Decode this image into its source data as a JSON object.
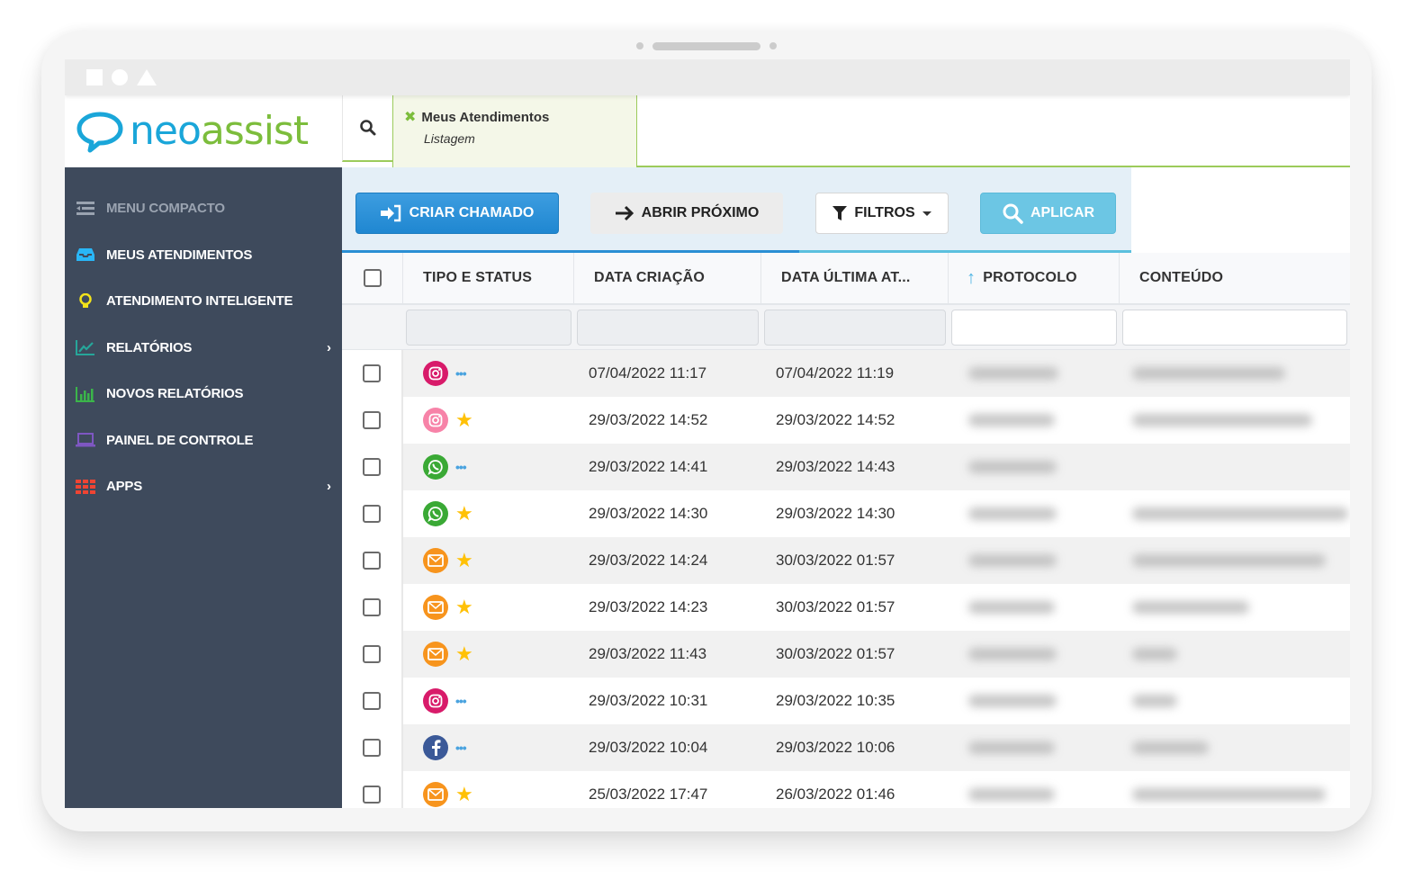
{
  "colors": {
    "brand_blue": "#1aa6d9",
    "brand_green": "#7cbd3c",
    "sidebar_bg": "#3e4a5c",
    "primary_button": "#1f87d1",
    "apply_button": "#6cc6e4",
    "star": "#ffc107",
    "instagram": "#d81b6a",
    "instagram_light": "#f783a8",
    "whatsapp": "#3aa935",
    "email": "#f7941d",
    "facebook": "#3b5998"
  },
  "header": {
    "logo_part1": "neo",
    "logo_part2": "assist",
    "search_icon": "search-icon",
    "active_tab": {
      "title": "Meus Atendimentos",
      "subtitle": "Listagem",
      "close_icon": "close-icon"
    }
  },
  "sidebar": {
    "items": [
      {
        "label": "MENU COMPACTO",
        "icon": "menu-compact-icon",
        "muted": true
      },
      {
        "label": "MEUS ATENDIMENTOS",
        "icon": "inbox-icon"
      },
      {
        "label": "ATENDIMENTO INTELIGENTE",
        "icon": "lightbulb-icon"
      },
      {
        "label": "RELATÓRIOS",
        "icon": "line-chart-icon",
        "has_submenu": true
      },
      {
        "label": "NOVOS RELATÓRIOS",
        "icon": "bar-chart-icon"
      },
      {
        "label": "PAINEL DE CONTROLE",
        "icon": "laptop-icon"
      },
      {
        "label": "APPS",
        "icon": "apps-grid-icon",
        "has_submenu": true
      }
    ]
  },
  "toolbar": {
    "create_label": "CRIAR CHAMADO",
    "next_label": "ABRIR PRÓXIMO",
    "filters_label": "FILTROS",
    "apply_label": "APLICAR"
  },
  "table": {
    "columns": [
      "TIPO E STATUS",
      "DATA CRIAÇÃO",
      "DATA ÚLTIMA AT...",
      "PROTOCOLO",
      "CONTEÚDO"
    ],
    "sorted_column": "PROTOCOLO",
    "sort_direction": "ascending",
    "rows": [
      {
        "channel": "instagram",
        "status": "in-progress",
        "created": "07/04/2022 11:17",
        "updated": "07/04/2022 11:19",
        "protocol": "",
        "content": ""
      },
      {
        "channel": "instagram-light",
        "status": "starred",
        "created": "29/03/2022 14:52",
        "updated": "29/03/2022 14:52",
        "protocol": "",
        "content": ""
      },
      {
        "channel": "whatsapp",
        "status": "in-progress",
        "created": "29/03/2022 14:41",
        "updated": "29/03/2022 14:43",
        "protocol": "",
        "content": ""
      },
      {
        "channel": "whatsapp",
        "status": "starred",
        "created": "29/03/2022 14:30",
        "updated": "29/03/2022 14:30",
        "protocol": "",
        "content": ""
      },
      {
        "channel": "email",
        "status": "starred",
        "created": "29/03/2022 14:24",
        "updated": "30/03/2022 01:57",
        "protocol": "",
        "content": ""
      },
      {
        "channel": "email",
        "status": "starred",
        "created": "29/03/2022 14:23",
        "updated": "30/03/2022 01:57",
        "protocol": "",
        "content": ""
      },
      {
        "channel": "email",
        "status": "starred",
        "created": "29/03/2022 11:43",
        "updated": "30/03/2022 01:57",
        "protocol": "",
        "content": ""
      },
      {
        "channel": "instagram",
        "status": "in-progress",
        "created": "29/03/2022 10:31",
        "updated": "29/03/2022 10:35",
        "protocol": "",
        "content": ""
      },
      {
        "channel": "facebook",
        "status": "in-progress",
        "created": "29/03/2022 10:04",
        "updated": "29/03/2022 10:06",
        "protocol": "",
        "content": ""
      },
      {
        "channel": "email",
        "status": "starred",
        "created": "25/03/2022 17:47",
        "updated": "26/03/2022 01:46",
        "protocol": "",
        "content": ""
      }
    ],
    "redacted_columns": [
      "PROTOCOLO",
      "CONTEÚDO"
    ]
  }
}
